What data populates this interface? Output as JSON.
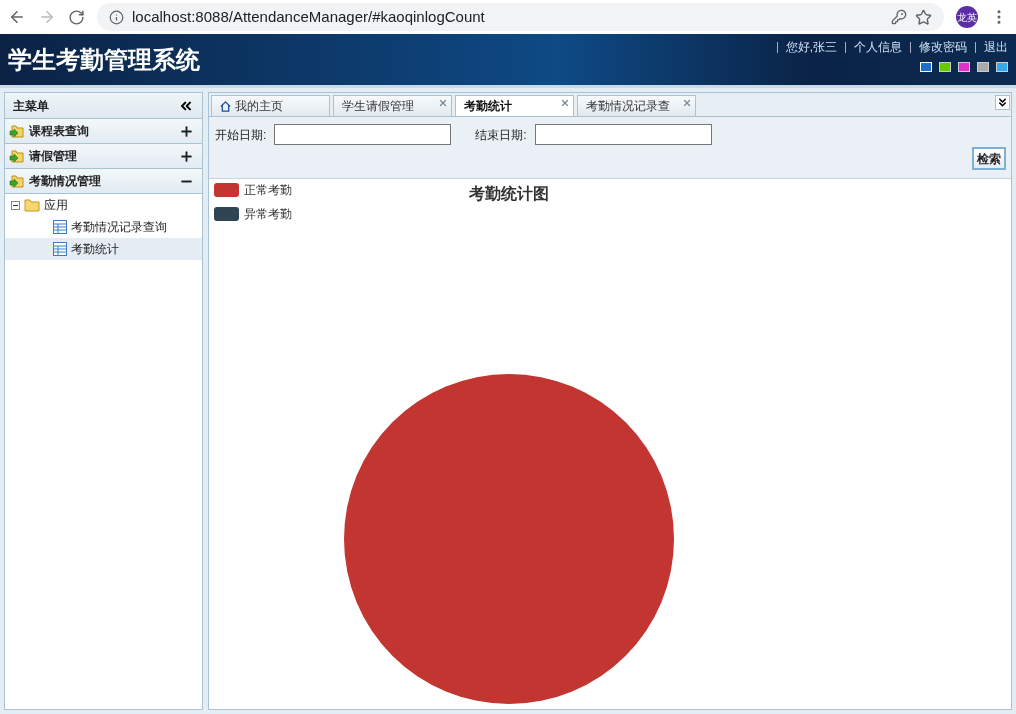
{
  "browser": {
    "url": "localhost:8088/AttendanceManager/#kaoqinlogCount",
    "profile": "龙英"
  },
  "header": {
    "title": "学生考勤管理系统",
    "links": [
      "您好,张三",
      "个人信息",
      "修改密码",
      "退出"
    ],
    "themes": [
      {
        "color": "#1e6fc8",
        "selected": true
      },
      {
        "color": "#66cc00",
        "selected": false
      },
      {
        "color": "#dd33cc",
        "selected": false
      },
      {
        "color": "#aaaaaa",
        "selected": false
      },
      {
        "color": "#33aaee",
        "selected": false
      }
    ]
  },
  "sidebar": {
    "title": "主菜单",
    "sections": [
      {
        "label": "课程表查询",
        "expanded": false
      },
      {
        "label": "请假管理",
        "expanded": false
      },
      {
        "label": "考勤情况管理",
        "expanded": true,
        "tree": [
          {
            "label": "应用",
            "expanded": true,
            "children": [
              {
                "label": "考勤情况记录查询",
                "selected": false
              },
              {
                "label": "考勤统计",
                "selected": true
              }
            ]
          }
        ]
      }
    ]
  },
  "tabs": [
    {
      "label": "我的主页",
      "kind": "home",
      "selected": false
    },
    {
      "label": "学生请假管理",
      "kind": "closable",
      "selected": false
    },
    {
      "label": "考勤统计",
      "kind": "closable",
      "selected": true
    },
    {
      "label": "考勤情况记录查",
      "kind": "closable",
      "selected": false
    }
  ],
  "filter": {
    "start_label": "开始日期:",
    "end_label": "结束日期:",
    "button": "检索"
  },
  "chart": {
    "chart_data": {
      "type": "pie",
      "title": "考勤统计图",
      "categories": [
        "正常考勤",
        "异常考勤"
      ],
      "series": [
        {
          "values": [
            100,
            0
          ]
        }
      ],
      "colors": [
        "#c23531",
        "#2f4554"
      ]
    }
  }
}
